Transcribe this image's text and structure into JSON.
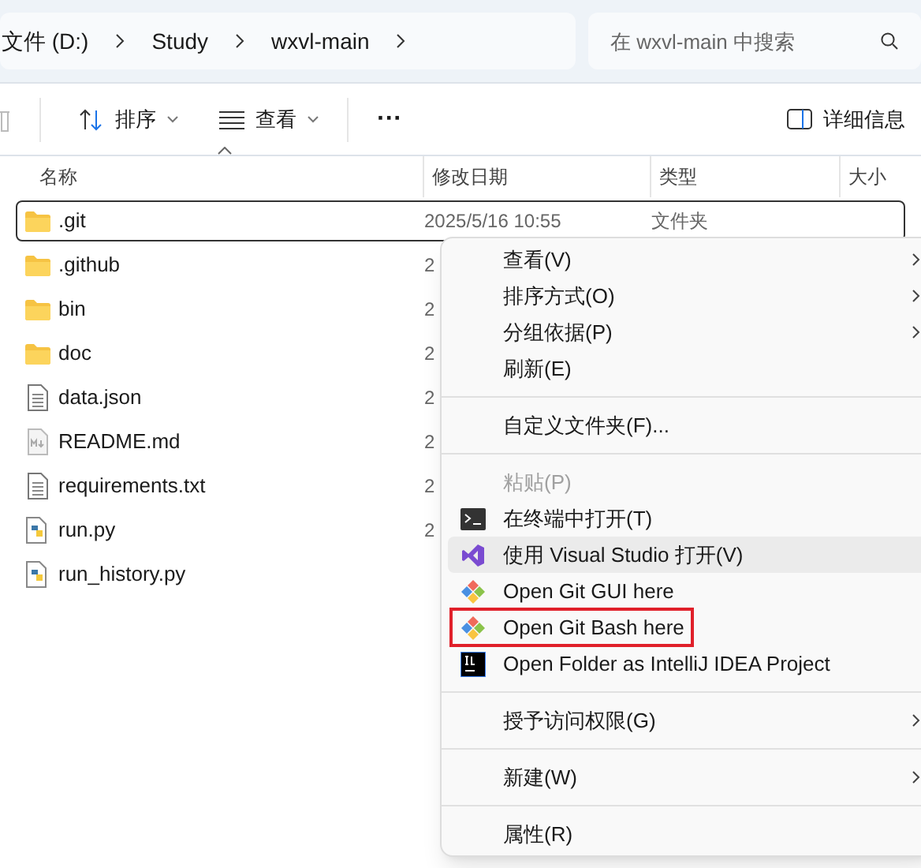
{
  "address_bar": {
    "crumbs": [
      "文件 (D:)",
      "Study",
      "wxvl-main"
    ]
  },
  "search": {
    "placeholder": "在 wxvl-main 中搜索"
  },
  "toolbar": {
    "sort": "排序",
    "view": "查看",
    "more": "···",
    "details": "详细信息"
  },
  "columns": [
    "名称",
    "修改日期",
    "类型",
    "大小"
  ],
  "files": [
    {
      "name": ".git",
      "kind": "folder",
      "selected": true,
      "date": "2025/5/16 10:55",
      "type": "文件夹"
    },
    {
      "name": ".github",
      "kind": "folder",
      "selected": false,
      "date": "2"
    },
    {
      "name": "bin",
      "kind": "folder",
      "selected": false,
      "date": "2"
    },
    {
      "name": "doc",
      "kind": "folder",
      "selected": false,
      "date": "2"
    },
    {
      "name": "data.json",
      "kind": "text",
      "selected": false,
      "date": "2"
    },
    {
      "name": "README.md",
      "kind": "markdown",
      "selected": false,
      "date": "2"
    },
    {
      "name": "requirements.txt",
      "kind": "text",
      "selected": false,
      "date": "2"
    },
    {
      "name": "run.py",
      "kind": "python",
      "selected": false,
      "date": "2"
    },
    {
      "name": "run_history.py",
      "kind": "python",
      "selected": false
    }
  ],
  "context_menu": {
    "items": [
      {
        "kind": "plain",
        "label": "查看(V)",
        "submenu": true,
        "disabled": false,
        "selected": false,
        "outlined": false
      },
      {
        "kind": "plain",
        "label": "排序方式(O)",
        "submenu": true,
        "disabled": false,
        "selected": false,
        "outlined": false
      },
      {
        "kind": "plain",
        "label": "分组依据(P)",
        "submenu": true,
        "disabled": false,
        "selected": false,
        "outlined": false
      },
      {
        "kind": "plain",
        "label": "刷新(E)",
        "submenu": false,
        "disabled": false,
        "selected": false,
        "outlined": false
      },
      {
        "kind": "separator"
      },
      {
        "kind": "plain",
        "label": "自定义文件夹(F)...",
        "submenu": false,
        "disabled": false,
        "selected": false,
        "outlined": false
      },
      {
        "kind": "separator"
      },
      {
        "kind": "plain",
        "label": "粘贴(P)",
        "submenu": false,
        "disabled": true,
        "selected": false,
        "outlined": false
      },
      {
        "kind": "terminal",
        "label": "在终端中打开(T)",
        "submenu": false,
        "disabled": false,
        "selected": false,
        "outlined": false
      },
      {
        "kind": "visual-studio",
        "label": "使用 Visual Studio 打开(V)",
        "submenu": false,
        "disabled": false,
        "selected": true,
        "outlined": false
      },
      {
        "kind": "git",
        "label": "Open Git GUI here",
        "submenu": false,
        "disabled": false,
        "selected": false,
        "outlined": false
      },
      {
        "kind": "git",
        "label": "Open Git Bash here",
        "submenu": false,
        "disabled": false,
        "selected": false,
        "outlined": true
      },
      {
        "kind": "intellij",
        "label": "Open Folder as IntelliJ IDEA Project",
        "submenu": false,
        "disabled": false,
        "selected": false,
        "outlined": false
      },
      {
        "kind": "separator"
      },
      {
        "kind": "plain",
        "label": "授予访问权限(G)",
        "submenu": true,
        "disabled": false,
        "selected": false,
        "outlined": false
      },
      {
        "kind": "separator"
      },
      {
        "kind": "plain",
        "label": "新建(W)",
        "submenu": true,
        "disabled": false,
        "selected": false,
        "outlined": false
      },
      {
        "kind": "separator"
      },
      {
        "kind": "plain",
        "label": "属性(R)",
        "submenu": false,
        "disabled": false,
        "selected": false,
        "outlined": false
      }
    ]
  }
}
